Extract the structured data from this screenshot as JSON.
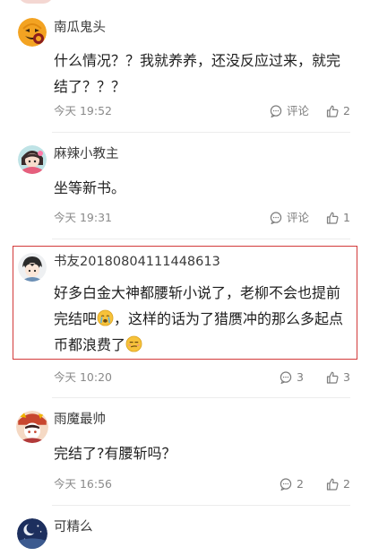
{
  "comments": [
    {
      "username": "南瓜鬼头",
      "text": "什么情况？？我就养养，还没反应过来，就完结了？？？",
      "time": "今天 19:52",
      "comment_label": "评论",
      "likes": "2",
      "avatar_icon": "pumpkin-avatar-icon"
    },
    {
      "username": "麻辣小教主",
      "text": "坐等新书。",
      "time": "今天 19:31",
      "comment_label": "评论",
      "likes": "1",
      "avatar_icon": "cartoon-girl-avatar-icon"
    },
    {
      "username": "书友20180804111448613",
      "text_part1": "好多白金大神都腰斩小说了，老柳不会也提前完结吧",
      "text_part2": "，这样的话为了猎赝冲的那么多起点币都浪费了",
      "time": "今天 10:20",
      "comment_count": "3",
      "likes": "3",
      "avatar_icon": "anime-boy-avatar-icon",
      "emoji1": "crying-emoji-icon",
      "emoji2": "smirk-emoji-icon"
    },
    {
      "username": "雨魔最帅",
      "text": "完结了?有腰斩吗？",
      "time": "今天 16:56",
      "comment_count": "2",
      "likes": "2",
      "avatar_icon": "anime-character-avatar-icon"
    },
    {
      "username": "可精么",
      "avatar_icon": "night-moon-avatar-icon"
    }
  ],
  "colors": {
    "highlight_border": "#d33a3a",
    "meta_text": "#8a8a8a"
  }
}
